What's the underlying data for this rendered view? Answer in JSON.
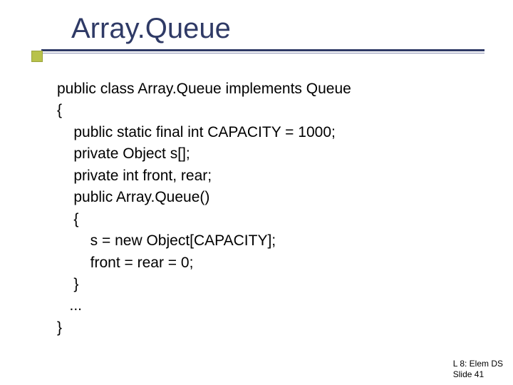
{
  "title": "Array.Queue",
  "code": {
    "l1": "public class Array.Queue implements Queue",
    "l2": "{",
    "l3": "    public static final int CAPACITY = 1000;",
    "l4": "    private Object s[];",
    "l5": "    private int front, rear;",
    "l6": "    public Array.Queue()",
    "l7": "    {",
    "l8": "        s = new Object[CAPACITY];",
    "l9": "        front = rear = 0;",
    "l10": "    }",
    "l11": "   ...",
    "l12": "}"
  },
  "footer": {
    "line1": "L 8: Elem DS",
    "line2": "Slide 41"
  }
}
